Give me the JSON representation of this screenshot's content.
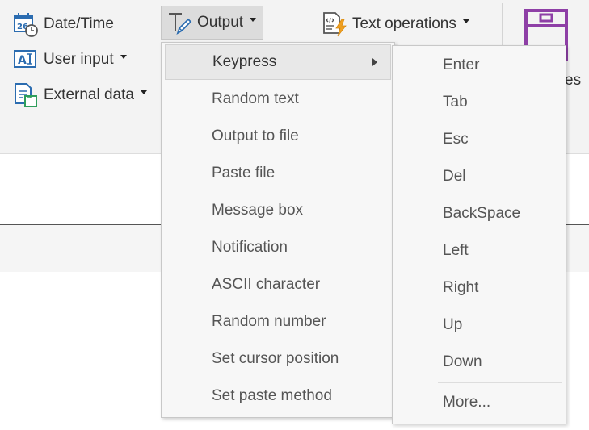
{
  "ribbon": {
    "datetime_label": "Date/Time",
    "userinput_label": "User input",
    "external_label": "External data",
    "output_label": "Output",
    "textops_label": "Text operations",
    "partial_label": "es"
  },
  "output_menu": {
    "items": [
      {
        "label": "Keypress",
        "has_submenu": true,
        "highlighted": true
      },
      {
        "label": "Random text"
      },
      {
        "label": "Output to file"
      },
      {
        "label": "Paste file"
      },
      {
        "label": "Message box"
      },
      {
        "label": "Notification"
      },
      {
        "label": "ASCII character"
      },
      {
        "label": "Random number"
      },
      {
        "label": "Set cursor position"
      },
      {
        "label": "Set paste method"
      }
    ]
  },
  "keypress_submenu": {
    "items": [
      "Enter",
      "Tab",
      "Esc",
      "Del",
      "BackSpace",
      "Left",
      "Right",
      "Up",
      "Down"
    ],
    "more_label": "More..."
  },
  "colors": {
    "accent_blue": "#2b6cb0",
    "accent_green": "#2e9e5b",
    "accent_orange": "#f0a020",
    "accent_purple": "#8e3fa6",
    "ribbon_bg": "#f3f3f3",
    "menu_bg": "#f7f7f7"
  },
  "icons": {
    "datetime": "calendar-clock-icon",
    "userinput": "text-input-icon",
    "external": "document-import-icon",
    "output": "text-pen-icon",
    "textops": "code-document-icon",
    "big": "purple-frame-icon"
  }
}
